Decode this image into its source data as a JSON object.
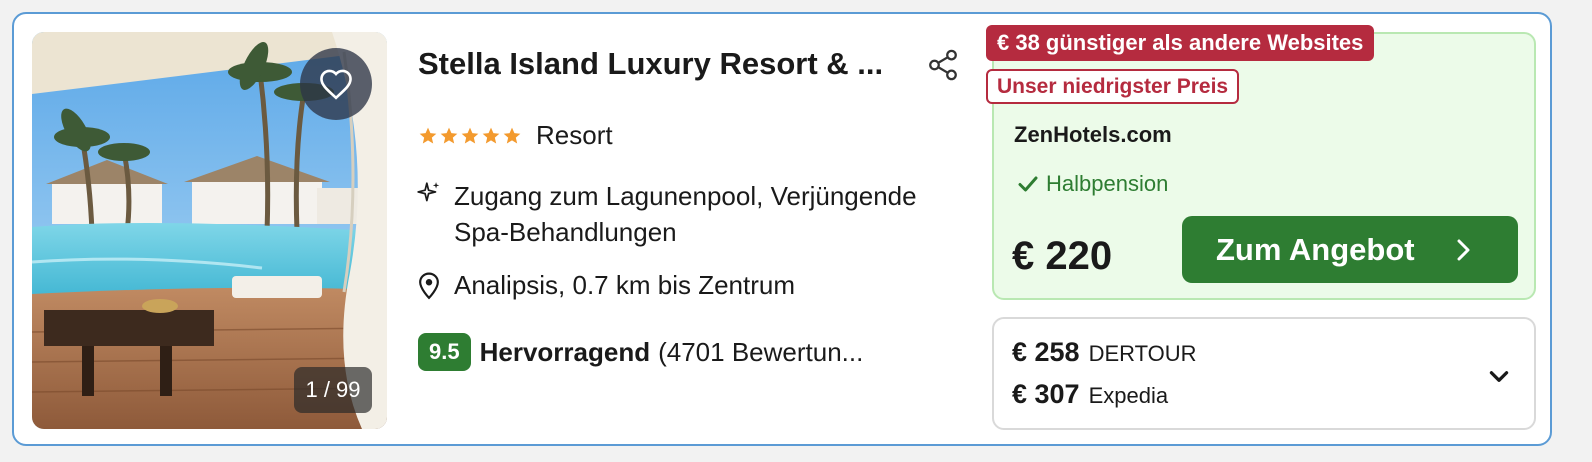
{
  "hotel": {
    "name": "Stella Island Luxury Resort & ...",
    "stars": 5,
    "type": "Resort",
    "features": "Zugang zum Lagunenpool, Verjüngende Spa-Behandlungen",
    "location": "Analipsis, 0.7 km bis Zentrum",
    "rating": {
      "score": "9.5",
      "label": "Hervorragend",
      "count": "(4701 Bewertun..."
    }
  },
  "gallery": {
    "counter": "1 / 99"
  },
  "offer": {
    "savings_badge": "€ 38 günstiger als andere Websites",
    "lowest_badge": "Unser niedrigster Preis",
    "provider": "ZenHotels.com",
    "board": "Halbpension",
    "price": "€ 220",
    "cta_label": "Zum Angebot"
  },
  "other_prices": [
    {
      "price": "€ 258",
      "site": "DERTOUR"
    },
    {
      "price": "€ 307",
      "site": "Expedia"
    }
  ],
  "colors": {
    "accent_green": "#2e7d32",
    "badge_red": "#b52b3f",
    "star_orange": "#f39a2e",
    "card_border": "#5b9bd5",
    "offer_bg": "#ecfbe9"
  },
  "icons": {
    "favorite": "heart-icon",
    "share": "share-icon",
    "feature": "sparkle-icon",
    "location": "map-pin-icon",
    "check": "check-icon",
    "cta": "chevron-right-icon",
    "expand": "chevron-down-icon"
  }
}
